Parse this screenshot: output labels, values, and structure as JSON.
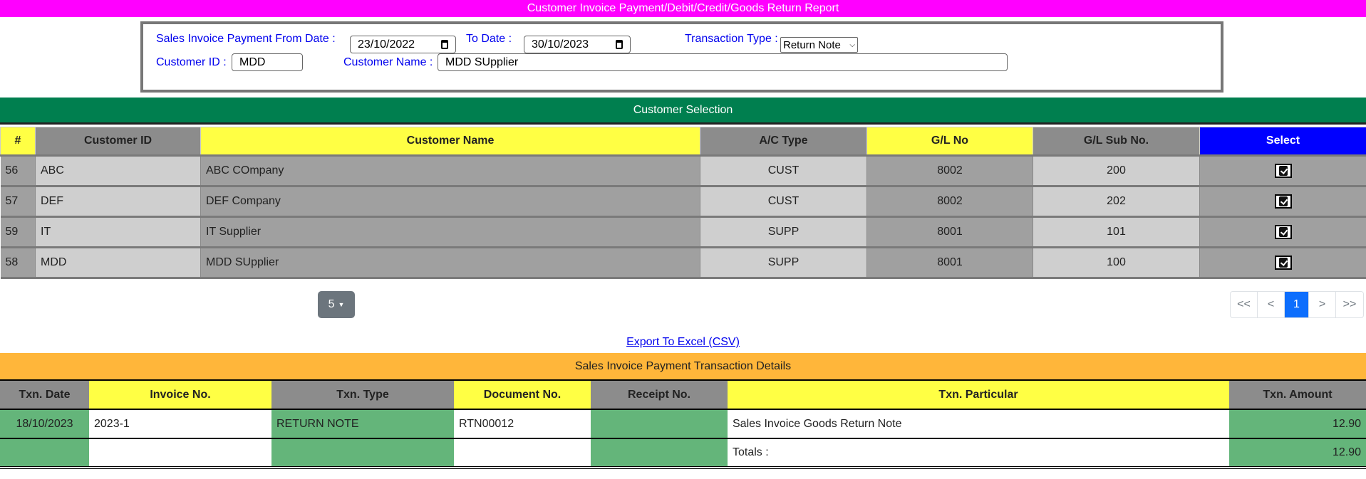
{
  "title": "Customer Invoice Payment/Debit/Credit/Goods Return Report",
  "filters": {
    "from_date_label": "Sales Invoice Payment From Date :",
    "from_date": "23/10/2022",
    "to_date_label": "To Date :",
    "to_date": "30/10/2023",
    "txn_type_label": "Transaction Type :",
    "txn_type": "Return Note",
    "customer_id_label": "Customer ID :",
    "customer_id": "MDD",
    "customer_name_label": "Customer Name :",
    "customer_name": "MDD SUpplier"
  },
  "customer_selection": {
    "title": "Customer Selection",
    "headers": [
      "#",
      "Customer ID",
      "Customer Name",
      "A/C Type",
      "G/L No",
      "G/L Sub No.",
      "Select"
    ],
    "rows": [
      {
        "no": "56",
        "id": "ABC",
        "name": "ABC COmpany",
        "type": "CUST",
        "gl": "8002",
        "sub": "200",
        "selected": true
      },
      {
        "no": "57",
        "id": "DEF",
        "name": "DEF Company",
        "type": "CUST",
        "gl": "8002",
        "sub": "202",
        "selected": true
      },
      {
        "no": "59",
        "id": "IT",
        "name": "IT Supplier",
        "type": "SUPP",
        "gl": "8001",
        "sub": "101",
        "selected": true
      },
      {
        "no": "58",
        "id": "MDD",
        "name": "MDD SUpplier",
        "type": "SUPP",
        "gl": "8001",
        "sub": "100",
        "selected": true
      }
    ]
  },
  "pagination": {
    "page_size": "5",
    "first": "<<",
    "prev": "<",
    "current": "1",
    "next": ">",
    "last": ">>"
  },
  "export_label": "Export To Excel (CSV)",
  "transactions": {
    "title": "Sales Invoice Payment Transaction Details",
    "headers": [
      "Txn. Date",
      "Invoice No.",
      "Txn. Type",
      "Document No.",
      "Receipt No.",
      "Txn. Particular",
      "Txn. Amount"
    ],
    "rows": [
      {
        "date": "18/10/2023",
        "invoice": "2023-1",
        "type": "RETURN NOTE",
        "doc": "RTN00012",
        "receipt": "",
        "particular": "Sales Invoice Goods Return Note",
        "amount": "12.90"
      }
    ],
    "totals_label": "Totals :",
    "total_amount": "12.90"
  }
}
